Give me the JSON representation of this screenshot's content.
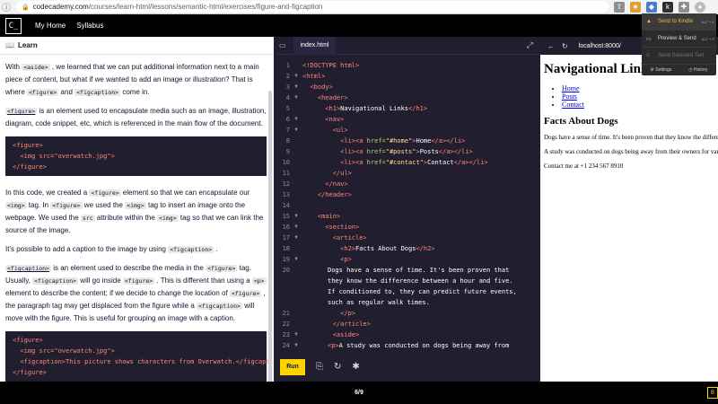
{
  "browser": {
    "url_host": "codecademy.com",
    "url_path": "/courses/learn-html/lessons/semantic-html/exercises/figure-and-figcaption"
  },
  "kindle_menu": {
    "send_to_kindle": "Send to Kindle",
    "send_shortcut": "ALT + K",
    "preview_send": "Preview & Send",
    "preview_shortcut": "ALT + P",
    "send_selected": "Send Selected Text",
    "settings": "Settings",
    "history": "History"
  },
  "header": {
    "logo": "C_",
    "nav": [
      "My Home",
      "Syllabus"
    ]
  },
  "learn": {
    "title": "Learn",
    "code_block_1": [
      "<figure>",
      "  <img src=\"overwatch.jpg\">",
      "</figure>"
    ],
    "code_block_2": [
      "<figure>",
      "  <img src=\"overwatch.jpg\">",
      "  <figcaption>This picture shows characters from Overwatch.</figcaption>",
      "</figure>"
    ]
  },
  "editor": {
    "tab": "index.html",
    "run_label": "Run"
  },
  "preview": {
    "url": "localhost:8000/",
    "h1": "Navigational Links",
    "links": [
      "Home",
      "Posts",
      "Contact"
    ],
    "h2": "Facts About Dogs",
    "p1": "Dogs have a sense of time. It's been proven that they know the difference between a hour and five. If conditioned to, they can predict future events, such as regular walk times.",
    "p2": "A study was conducted on dogs being away from their owners for varying hours and the studies show that dogs who were away from their owners the longest showed the greatest amount of affection!",
    "contact": "Contact me at +1 234 567 8910"
  },
  "footer": {
    "pager": "6/9",
    "next": "B"
  }
}
